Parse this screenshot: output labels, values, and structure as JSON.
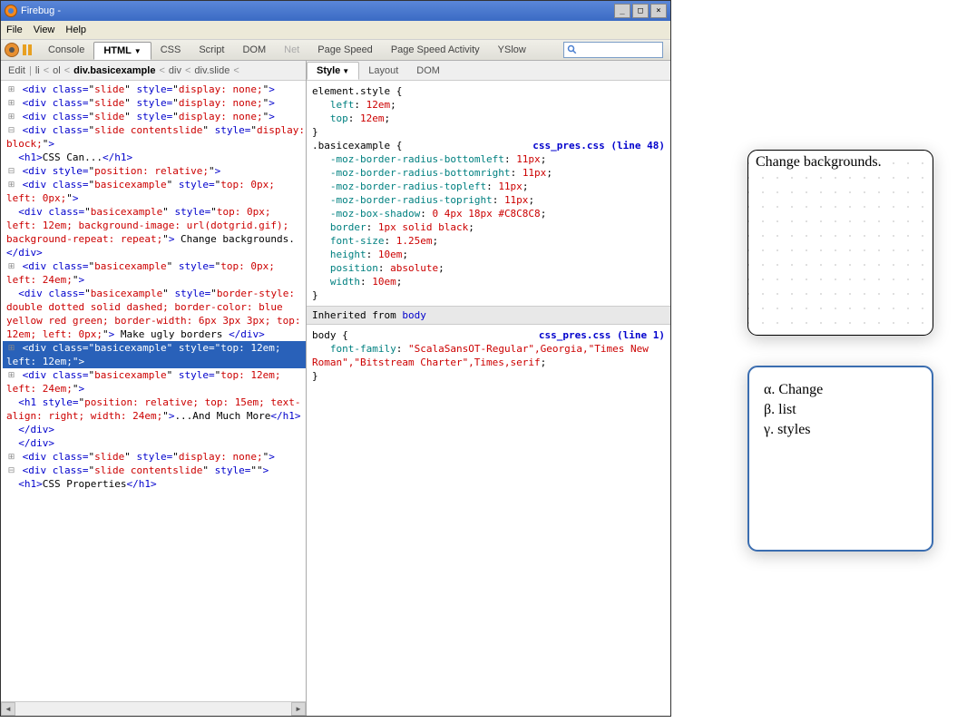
{
  "window": {
    "title": "Firebug - "
  },
  "menu": {
    "file": "File",
    "view": "View",
    "help": "Help"
  },
  "toolbar_tabs": {
    "console": "Console",
    "html": "HTML",
    "css": "CSS",
    "script": "Script",
    "dom": "DOM",
    "net": "Net",
    "pagespeed": "Page Speed",
    "psactivity": "Page Speed Activity",
    "yslow": "YSlow"
  },
  "breadcrumb": {
    "edit": "Edit",
    "items": [
      "li",
      "ol",
      "div.basicexample",
      "div",
      "div.slide"
    ]
  },
  "right_tabs": {
    "style": "Style",
    "layout": "Layout",
    "dom": "DOM"
  },
  "styles": {
    "element_style": {
      "selector": "element.style",
      "props": [
        {
          "name": "left",
          "value": "12em"
        },
        {
          "name": "top",
          "value": "12em"
        }
      ]
    },
    "src1": {
      "file": "css_pres.css",
      "line": "(line 48)"
    },
    "basicexample": {
      "selector": ".basicexample",
      "props": [
        {
          "name": "-moz-border-radius-bottomleft",
          "value": "11px"
        },
        {
          "name": "-moz-border-radius-bottomright",
          "value": "11px"
        },
        {
          "name": "-moz-border-radius-topleft",
          "value": "11px"
        },
        {
          "name": "-moz-border-radius-topright",
          "value": "11px"
        },
        {
          "name": "-moz-box-shadow",
          "value": "0 4px 18px #C8C8C8"
        },
        {
          "name": "border",
          "value": "1px solid black"
        },
        {
          "name": "font-size",
          "value": "1.25em"
        },
        {
          "name": "height",
          "value": "10em"
        },
        {
          "name": "position",
          "value": "absolute"
        },
        {
          "name": "width",
          "value": "10em"
        }
      ]
    },
    "inherited_label": "Inherited from ",
    "inherited_from": "body",
    "src2": {
      "file": "css_pres.css",
      "line": "(line 1)"
    },
    "body_rule": {
      "selector": "body",
      "props": [
        {
          "name": "font-family",
          "value": "\"ScalaSansOT-Regular\",Georgia,\"Times New Roman\",\"Bitstream Charter\",Times,serif"
        }
      ]
    }
  },
  "tree": {
    "slide_none_a": "<div class=\"slide\" style=\"display: none;\">",
    "slide_none_b": "<div class=\"slide\" style=\"display: none;\">",
    "slide_none_c": "<div class=\"slide\" style=\"display: none;\">",
    "slide_block": "<div class=\"slide contentslide\" style=\"display: block;\">",
    "h1_csscan_open": "<h1>",
    "h1_csscan_text": "CSS Can...",
    "h1_csscan_close": "</h1>",
    "div_rel": "<div style=\"position: relative;\">",
    "be_00": "<div class=\"basicexample\" style=\"top: 0px; left: 0px;\">",
    "be_012_full": "<div class=\"basicexample\" style=\"top: 0px; left: 12em; background-image: url(dotgrid.gif); background-repeat: repeat;\">",
    "be_012_text": " Change backgrounds. ",
    "be_012_close": "</div>",
    "be_024": "<div class=\"basicexample\" style=\"top: 0px; left: 24em;\">",
    "be_borders_full": "<div class=\"basicexample\" style=\"border-style: double dotted solid dashed; border-color: blue yellow red green; border-width: 6px 3px 3px; top: 12em; left: 0px;\">",
    "be_borders_text": " Make ugly borders ",
    "be_borders_close": "</div>",
    "be_1212": "<div class=\"basicexample\" style=\"top: 12em; left: 12em;\">",
    "be_1224": "<div class=\"basicexample\" style=\"top: 12em; left: 24em;\">",
    "h1_more": "<h1 style=\"position: relative; top: 15em; text-align: right; width: 24em;\">",
    "h1_more_text": "...And Much More",
    "h1_more_close": "</h1>",
    "closediv": "</div>",
    "slide_none_d": "<div class=\"slide\" style=\"display: none;\">",
    "slide_last": "<div class=\"slide contentslide\" style=\"\">",
    "h1_props_open": "<h1>",
    "h1_props_text": "CSS Properties",
    "h1_props_close": "</h1>"
  },
  "preview1": {
    "text": "Change backgrounds."
  },
  "preview2": {
    "items": [
      "α.  Change",
      "β.  list",
      "γ.  styles"
    ]
  }
}
